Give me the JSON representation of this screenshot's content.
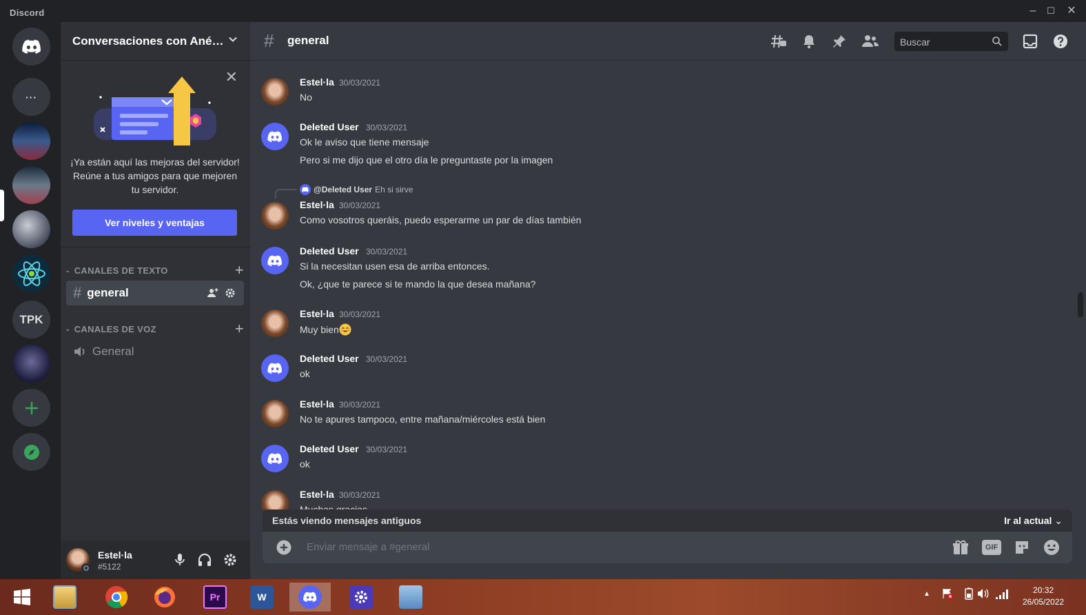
{
  "window": {
    "title": "Discord"
  },
  "server": {
    "name": "Conversaciones con Ané…",
    "promo": {
      "text": "¡Ya están aquí las mejoras del servidor! Reúne a tus amigos para que mejoren tu servidor.",
      "button": "Ver niveles y ventajas"
    },
    "categories": {
      "text": "CANALES DE TEXTO",
      "voice": "CANALES DE VOZ"
    },
    "channels": {
      "text": [
        {
          "name": "general",
          "active": true
        }
      ],
      "voice": [
        {
          "name": "General"
        }
      ]
    },
    "guild_labels": {
      "tpk": "TPK",
      "dm_more": "···"
    }
  },
  "user": {
    "name": "Estel·la",
    "tag": "#5122"
  },
  "channel_header": {
    "name": "general",
    "search_placeholder": "Buscar"
  },
  "messages": [
    {
      "author": "Estel·la",
      "time": "30/03/2021",
      "lines": [
        "No"
      ]
    },
    {
      "author": "Deleted User",
      "time": "30/03/2021",
      "lines": [
        "Ok le aviso que tiene mensaje",
        "Pero si me dijo que el otro día le preguntaste por  la imagen"
      ]
    },
    {
      "author": "Estel·la",
      "time": "30/03/2021",
      "reply": {
        "to": "@Deleted User",
        "text": "Eh  si sirve"
      },
      "lines": [
        "Como vosotros queráis, puedo esperarme un par de días también"
      ]
    },
    {
      "author": "Deleted User",
      "time": "30/03/2021",
      "lines": [
        "Si la necesitan usen esa de arriba entonces.",
        "Ok, ¿que te parece si te mando la que desea mañana?"
      ]
    },
    {
      "author": "Estel·la",
      "time": "30/03/2021",
      "lines": [
        "Muy bien"
      ]
    },
    {
      "author": "Deleted User",
      "time": "30/03/2021",
      "lines": [
        "ok"
      ]
    },
    {
      "author": "Estel·la",
      "time": "30/03/2021",
      "lines": [
        "No te apures tampoco, entre mañana/miércoles está bien"
      ]
    },
    {
      "author": "Deleted User",
      "time": "30/03/2021",
      "lines": [
        "ok"
      ]
    },
    {
      "author": "Estel·la",
      "time": "30/03/2021",
      "lines": [
        "Muchas gracias"
      ]
    }
  ],
  "old_messages_bar": {
    "text": "Estás viendo mensajes antiguos",
    "action": "Ir al actual"
  },
  "composer": {
    "placeholder": "Enviar mensaje a #general",
    "gif_label": "GIF"
  },
  "taskbar": {
    "apps": [
      "windows-start",
      "file-explorer",
      "chrome",
      "firefox",
      "premiere",
      "word",
      "discord",
      "settings",
      "calculator"
    ],
    "premiere_label": "Pr",
    "word_label": "W",
    "time": "20:32",
    "date": "26/05/2022"
  },
  "colors": {
    "blurple": "#5865f2",
    "bg_main": "#36393f",
    "bg_side": "#2f3136",
    "bg_dark": "#202225",
    "green": "#3ba55d"
  }
}
